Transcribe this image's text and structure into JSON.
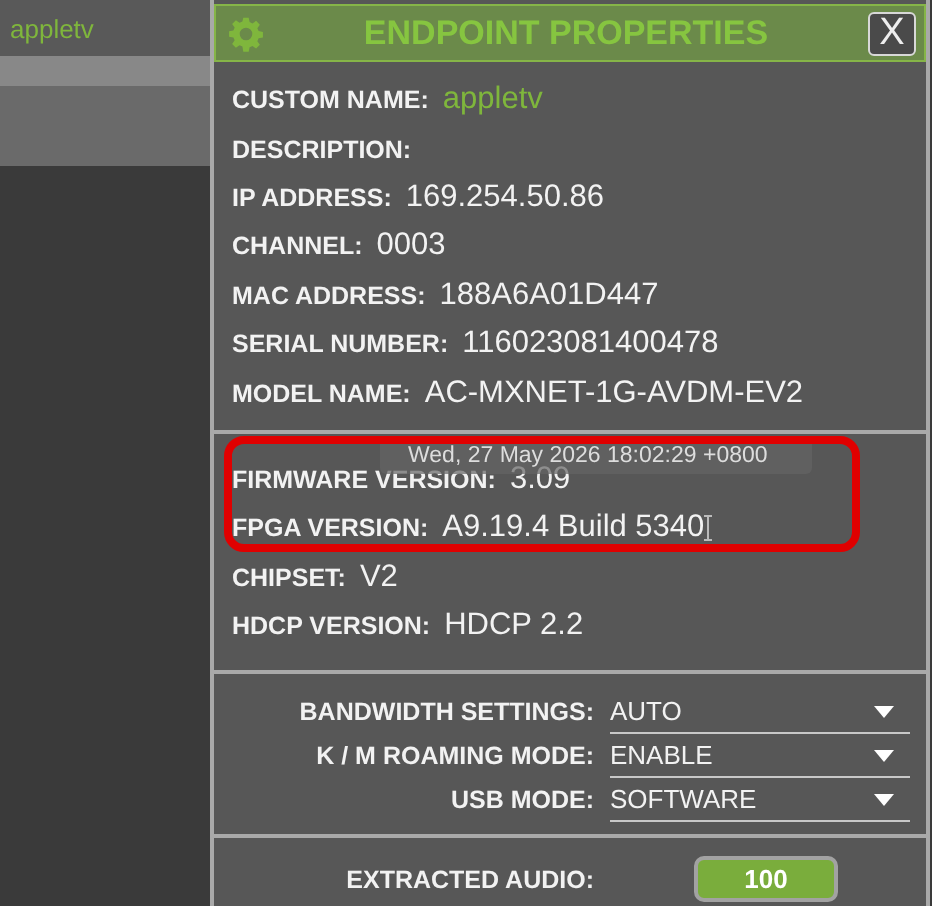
{
  "sidebar": {
    "item": "appletv"
  },
  "dialog": {
    "title": "ENDPOINT PROPERTIES",
    "close": "X",
    "info_rows": [
      {
        "label": "CUSTOM NAME:",
        "value": "appletv",
        "kind": "accent"
      },
      {
        "label": "DESCRIPTION:",
        "value": "",
        "kind": "plain"
      },
      {
        "label": "IP ADDRESS:",
        "value": "169.254.50.86",
        "kind": "plain"
      },
      {
        "label": "CHANNEL:",
        "value": "0003",
        "kind": "plain"
      },
      {
        "label": "MAC ADDRESS:",
        "value": "188A6A01D447",
        "kind": "plain"
      },
      {
        "label": "SERIAL NUMBER:",
        "value": "116023081400478",
        "kind": "plain"
      },
      {
        "label": "MODEL NAME:",
        "value": "AC-MXNET-1G-AVDM-EV2",
        "kind": "plain"
      }
    ],
    "version_rows": [
      {
        "label": "FIRMWARE VERSION:",
        "value": "3.09"
      },
      {
        "label": "FPGA VERSION:",
        "value": "A9.19.4 Build 5340"
      },
      {
        "label": "CHIPSET:",
        "value": "V2"
      },
      {
        "label": "HDCP VERSION:",
        "value": "HDCP 2.2"
      }
    ],
    "tooltip": "Wed, 27 May 2026 18:02:29 +0800",
    "settings": [
      {
        "label": "BANDWIDTH SETTINGS:",
        "value": "AUTO"
      },
      {
        "label": "K / M ROAMING MODE:",
        "value": "ENABLE"
      },
      {
        "label": "USB MODE:",
        "value": "SOFTWARE"
      }
    ],
    "audio": {
      "label": "EXTRACTED AUDIO:",
      "value": "100"
    }
  }
}
